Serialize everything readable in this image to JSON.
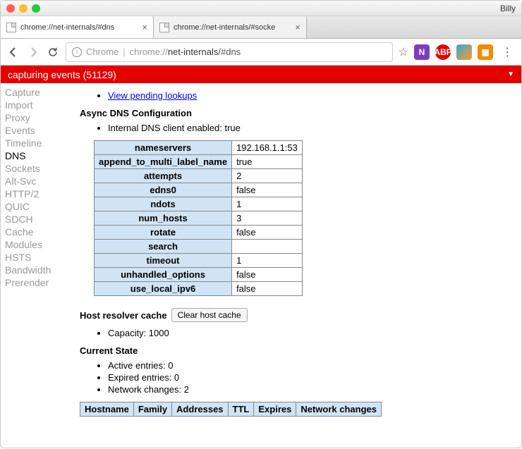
{
  "window": {
    "user": "Billy"
  },
  "tabs": [
    {
      "title": "chrome://net-internals/#dns",
      "active": true
    },
    {
      "title": "chrome://net-internals/#socke",
      "active": false
    }
  ],
  "url": {
    "scheme": "Chrome",
    "prefix": "chrome://",
    "host": "net-internals",
    "path": "/#dns"
  },
  "status": {
    "label": "capturing events",
    "count": "(51129)"
  },
  "sidebar": {
    "items": [
      {
        "label": "Capture"
      },
      {
        "label": "Import"
      },
      {
        "label": "Proxy"
      },
      {
        "label": "Events"
      },
      {
        "label": "Timeline"
      },
      {
        "label": "DNS",
        "active": true
      },
      {
        "label": "Sockets"
      },
      {
        "label": "Alt-Svc"
      },
      {
        "label": "HTTP/2"
      },
      {
        "label": "QUIC"
      },
      {
        "label": "SDCH"
      },
      {
        "label": "Cache"
      },
      {
        "label": "Modules"
      },
      {
        "label": "HSTS"
      },
      {
        "label": "Bandwidth"
      },
      {
        "label": "Prerender"
      }
    ]
  },
  "dns": {
    "pending_link": "View pending lookups",
    "section1": "Async DNS Configuration",
    "internal_line": "Internal DNS client enabled: true",
    "cfg": [
      [
        "nameservers",
        "192.168.1.1:53"
      ],
      [
        "append_to_multi_label_name",
        "true"
      ],
      [
        "attempts",
        "2"
      ],
      [
        "edns0",
        "false"
      ],
      [
        "ndots",
        "1"
      ],
      [
        "num_hosts",
        "3"
      ],
      [
        "rotate",
        "false"
      ],
      [
        "search",
        ""
      ],
      [
        "timeout",
        "1"
      ],
      [
        "unhandled_options",
        "false"
      ],
      [
        "use_local_ipv6",
        "false"
      ]
    ],
    "hrc_title": "Host resolver cache",
    "clear_btn": "Clear host cache",
    "capacity": "Capacity: 1000",
    "current_state": "Current State",
    "state_lines": [
      "Active entries: 0",
      "Expired entries: 0",
      "Network changes: 2"
    ],
    "state_headers": [
      "Hostname",
      "Family",
      "Addresses",
      "TTL",
      "Expires",
      "Network changes"
    ]
  }
}
